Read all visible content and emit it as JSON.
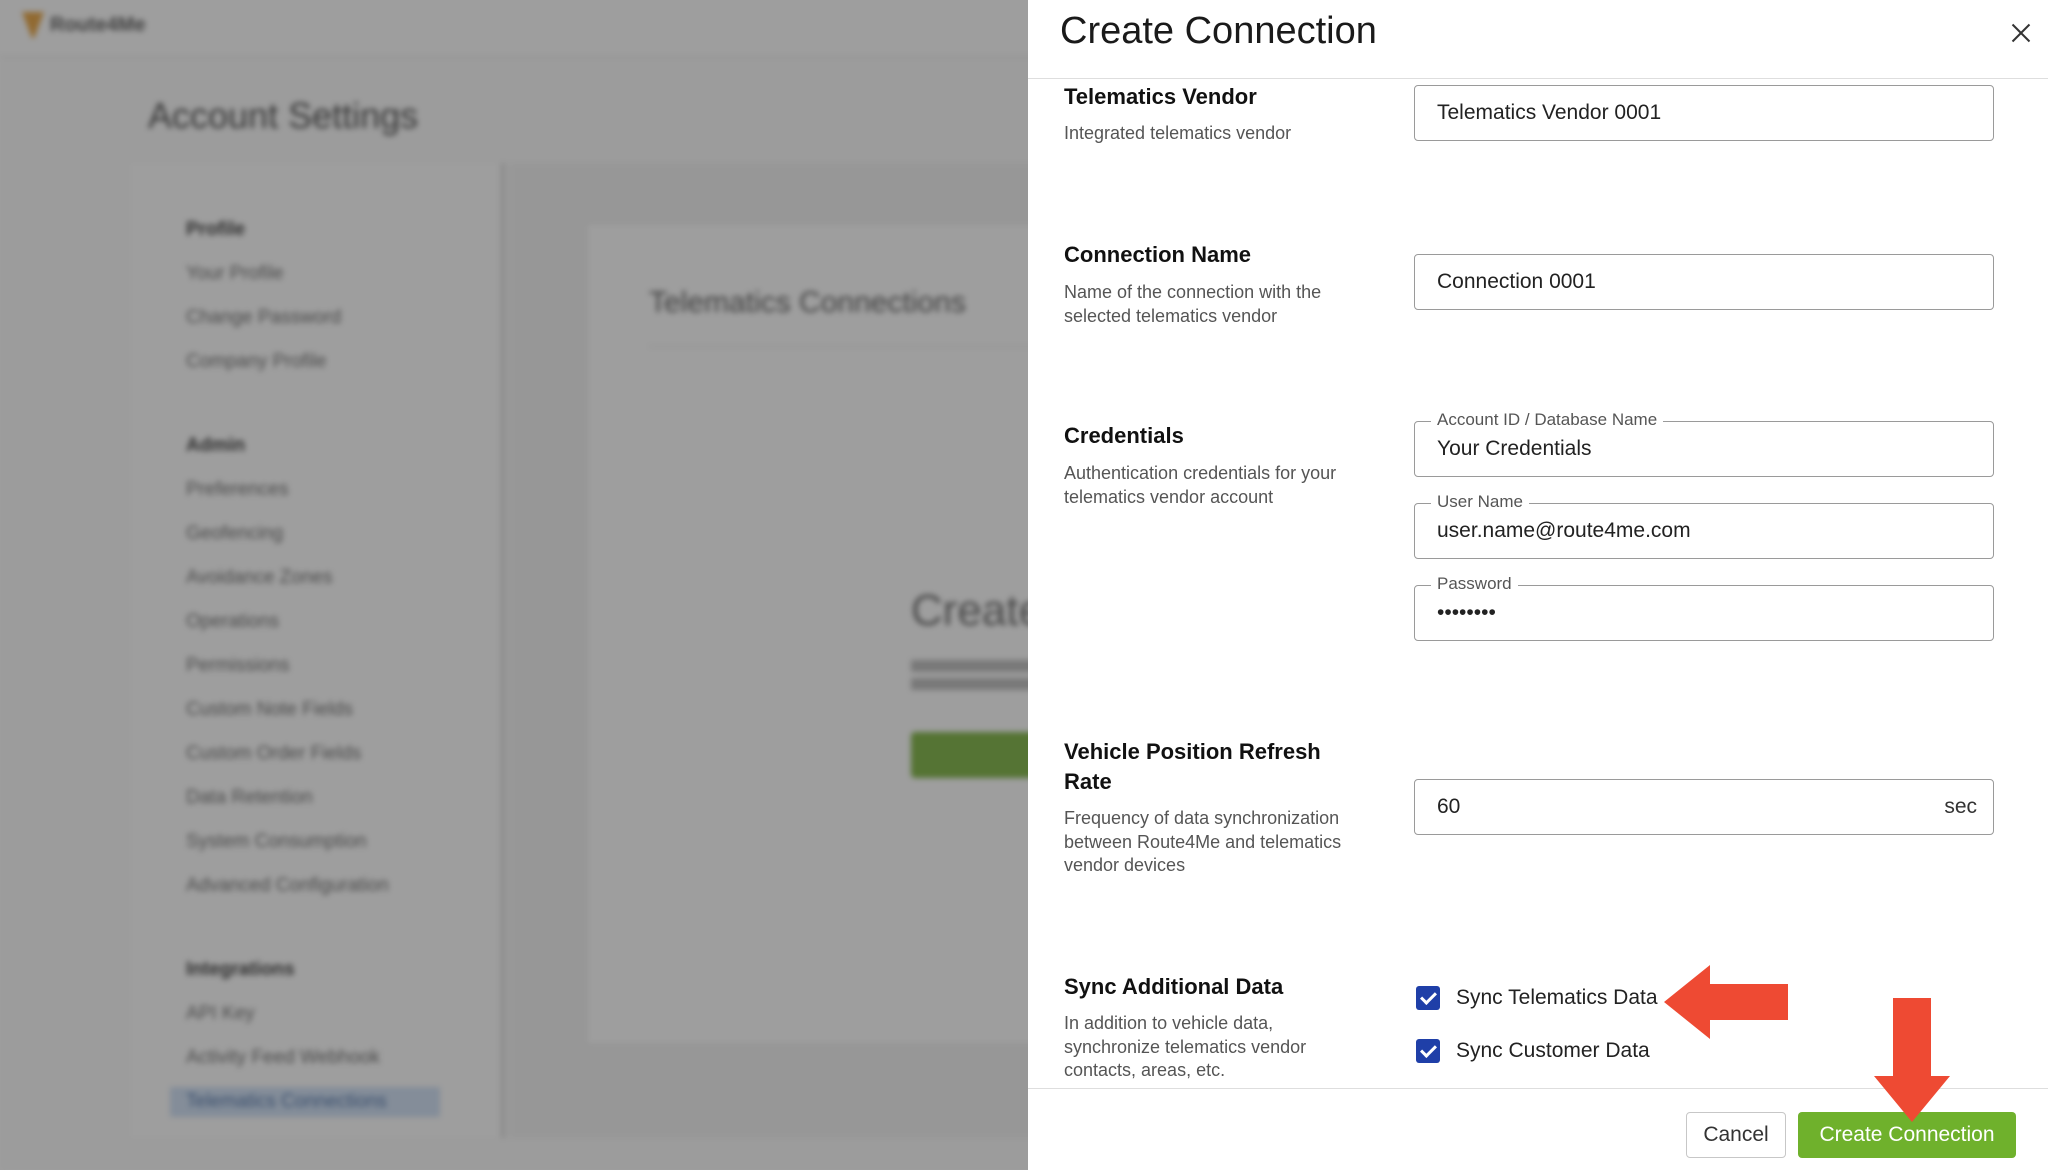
{
  "background": {
    "logo_text": "Route4Me",
    "page_title": "Account Settings",
    "sidebar": {
      "groups": [
        {
          "label": "Profile",
          "items": [
            "Your Profile",
            "Change Password",
            "Company Profile"
          ]
        },
        {
          "label": "Admin",
          "items": [
            "Preferences",
            "Geofencing",
            "Avoidance Zones",
            "Operations",
            "Permissions",
            "Custom Note Fields",
            "Custom Order Fields",
            "Data Retention",
            "System Consumption",
            "Advanced Configuration"
          ]
        },
        {
          "label": "Integrations",
          "items": [
            "API Key",
            "Activity Feed Webhook",
            "Telematics Connections"
          ]
        }
      ]
    },
    "main_title": "Telematics Connections",
    "create_heading": "Create"
  },
  "modal": {
    "title": "Create Connection",
    "vendor": {
      "label": "Telematics Vendor",
      "description": "Integrated telematics vendor",
      "value": "Telematics Vendor 0001"
    },
    "connection_name": {
      "label": "Connection Name",
      "description_line1": "Name of the connection with the",
      "description_line2": "selected telematics vendor",
      "value": "Connection 0001"
    },
    "credentials": {
      "label": "Credentials",
      "description_line1": "Authentication credentials for your",
      "description_line2": "telematics vendor account",
      "account_id_label": "Account ID / Database Name",
      "account_id_value": "Your Credentials",
      "username_label": "User Name",
      "username_value": "user.name@route4me.com",
      "password_label": "Password",
      "password_value": "••••••••"
    },
    "refresh_rate": {
      "label_line1": "Vehicle Position Refresh",
      "label_line2": "Rate",
      "description_line1": "Frequency of data synchronization",
      "description_line2": "between Route4Me and telematics",
      "description_line3": "vendor devices",
      "value": "60",
      "unit": "sec"
    },
    "sync": {
      "label": "Sync Additional Data",
      "description_line1": "In addition to vehicle data,",
      "description_line2": "synchronize telematics vendor",
      "description_line3": "contacts, areas, etc.",
      "telematics_label": "Sync Telematics Data",
      "telematics_checked": true,
      "customer_label": "Sync Customer Data",
      "customer_checked": true
    },
    "cancel_label": "Cancel",
    "create_label": "Create Connection"
  },
  "colors": {
    "accent_green": "#6fb12c",
    "checkbox_blue": "#1f3fa8",
    "annotation_red": "#ee4a33"
  }
}
